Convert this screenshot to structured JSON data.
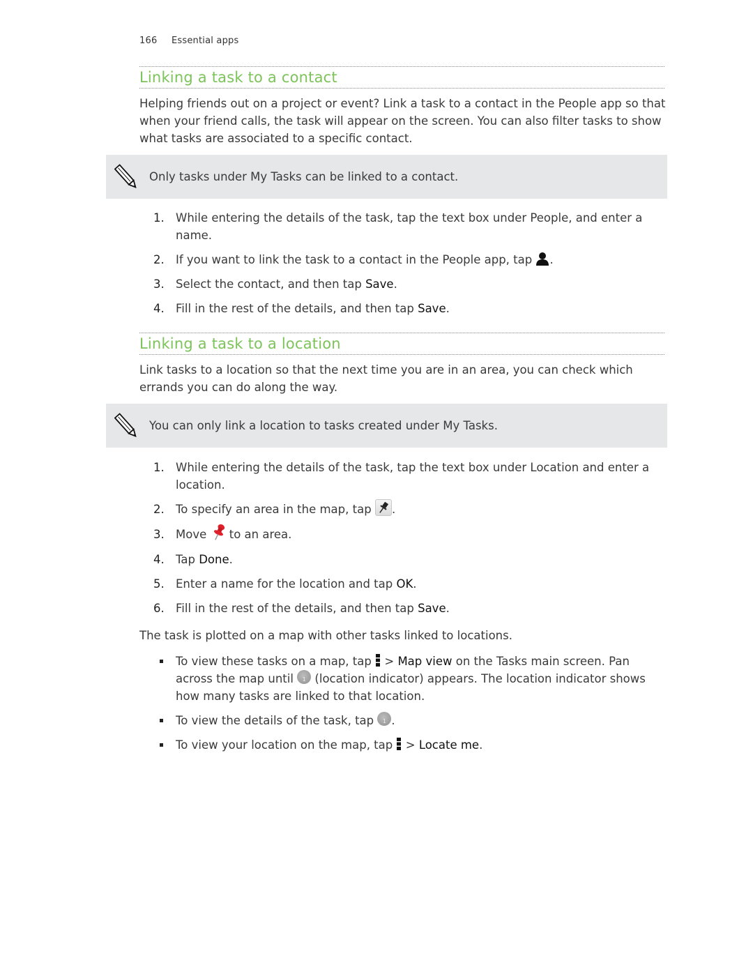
{
  "header": {
    "page_number": "166",
    "section": "Essential apps"
  },
  "contact_section": {
    "title": "Linking a task to a contact",
    "intro": "Helping friends out on a project or event? Link a task to a contact in the People app so that when your friend calls, the task will appear on the screen. You can also filter tasks to show what tasks are associated to a specific contact.",
    "note": "Only tasks under My Tasks can be linked to a contact.",
    "steps": [
      {
        "num": "1.",
        "text": "While entering the details of the task, tap the text box under People, and enter a name."
      },
      {
        "num": "2.",
        "text_before": "If you want to link the task to a contact in the People app, tap ",
        "icon": "person-icon",
        "text_after": "."
      },
      {
        "num": "3.",
        "text_before": "Select the contact, and then tap ",
        "keyword": "Save",
        "text_after": "."
      },
      {
        "num": "4.",
        "text_before": "Fill in the rest of the details, and then tap ",
        "keyword": "Save",
        "text_after": "."
      }
    ]
  },
  "location_section": {
    "title": "Linking a task to a location",
    "intro": "Link tasks to a location so that the next time you are in an area, you can check which errands you can do along the way.",
    "note": "You can only link a location to tasks created under My Tasks.",
    "steps": [
      {
        "num": "1.",
        "text": "While entering the details of the task, tap the text box under Location and enter a location."
      },
      {
        "num": "2.",
        "text_before": "To specify an area in the map, tap ",
        "icon": "pin-button-icon",
        "text_after": "."
      },
      {
        "num": "3.",
        "text_before": "Move ",
        "icon": "red-pushpin-icon",
        "text_after": " to an area."
      },
      {
        "num": "4.",
        "text_before": "Tap ",
        "keyword": "Done",
        "text_after": "."
      },
      {
        "num": "5.",
        "text_before": "Enter a name for the location and tap ",
        "keyword": "OK",
        "text_after": "."
      },
      {
        "num": "6.",
        "text_before": "Fill in the rest of the details, and then tap ",
        "keyword": "Save",
        "text_after": "."
      }
    ],
    "summary": "The task is plotted on a map with other tasks linked to locations.",
    "bullets": [
      {
        "p1": "To view these tasks on a map, tap ",
        "icon1": "menu-icon",
        "p2": " > ",
        "kw": "Map view",
        "p3": " on the Tasks main screen. Pan across the map until ",
        "icon2": "location-indicator-icon",
        "p4": " (location indicator) appears. The location indicator shows how many tasks are linked to that location."
      },
      {
        "p1": "To view the details of the task, tap ",
        "icon1": "location-indicator-icon",
        "p2": "."
      },
      {
        "p1": "To view your location on the map, tap ",
        "icon1": "menu-icon",
        "p2": " > ",
        "kw": "Locate me",
        "p3": "."
      }
    ],
    "indicator_count": "1"
  },
  "colors": {
    "heading": "#7cc35a",
    "note_bg": "#e6e7e8",
    "body_text": "#3a3a3a",
    "pin_red": "#e0202a"
  }
}
